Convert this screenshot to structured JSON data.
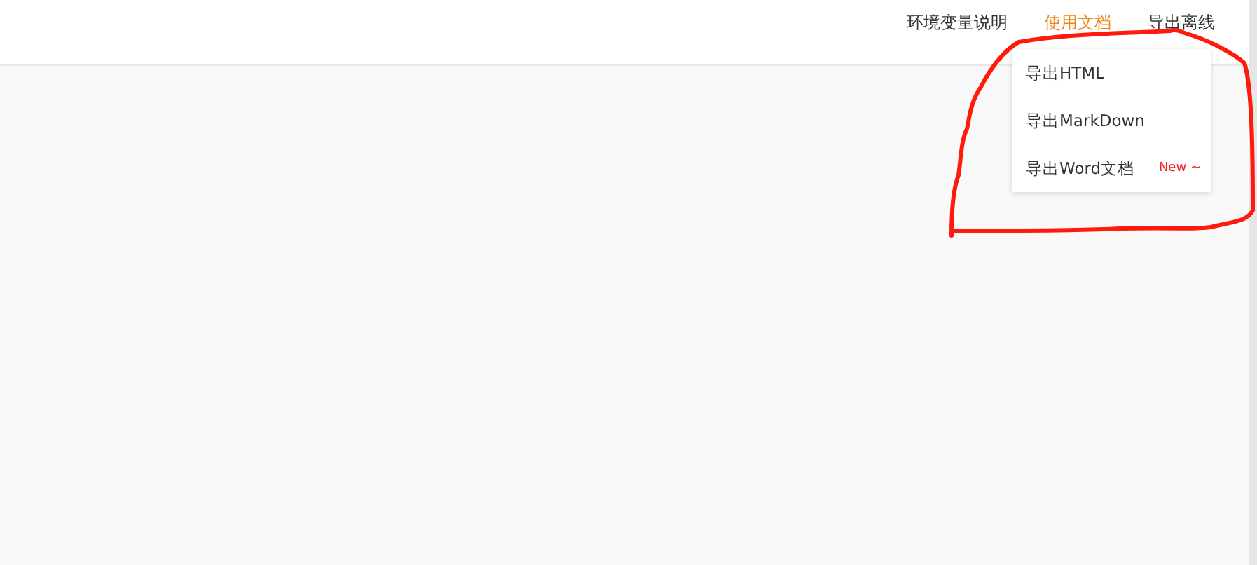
{
  "nav": [
    {
      "label": "环境变量说明",
      "selected": false
    },
    {
      "label": "使用文档",
      "selected": true
    },
    {
      "label": "导出离线",
      "selected": false
    }
  ],
  "dropdown": {
    "items": [
      {
        "label": "导出HTML"
      },
      {
        "label": "导出MarkDown"
      },
      {
        "label": "导出Word文档",
        "badge": "New ~"
      }
    ]
  },
  "annotations": [
    {
      "kind": "freehand-loop"
    }
  ]
}
